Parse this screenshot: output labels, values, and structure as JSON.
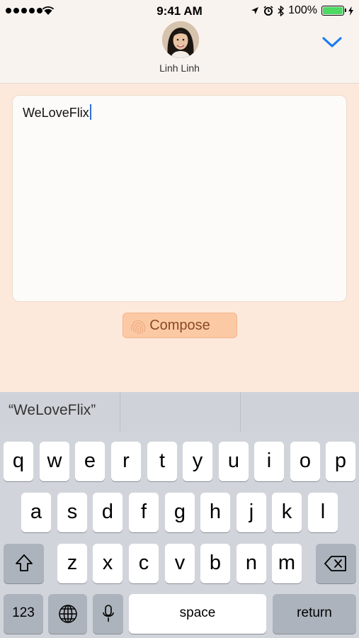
{
  "status_bar": {
    "time": "9:41 AM",
    "battery": "100%"
  },
  "header": {
    "contact_name": "Linh Linh"
  },
  "message": {
    "text": "WeLoveFlix"
  },
  "compose_button": {
    "label": "Compose"
  },
  "predictive": {
    "suggestions": [
      "“WeLoveFlix”",
      "",
      ""
    ]
  },
  "keyboard": {
    "row1": [
      "q",
      "w",
      "e",
      "r",
      "t",
      "y",
      "u",
      "i",
      "o",
      "p"
    ],
    "row2": [
      "a",
      "s",
      "d",
      "f",
      "g",
      "h",
      "j",
      "k",
      "l"
    ],
    "row3": [
      "z",
      "x",
      "c",
      "v",
      "b",
      "n",
      "m"
    ],
    "numbers_label": "123",
    "space_label": "space",
    "return_label": "return"
  },
  "colors": {
    "background": "#fde9dc",
    "accent": "#1a7cf5",
    "compose_button": "#fcc9a5",
    "battery": "#4cd964"
  }
}
